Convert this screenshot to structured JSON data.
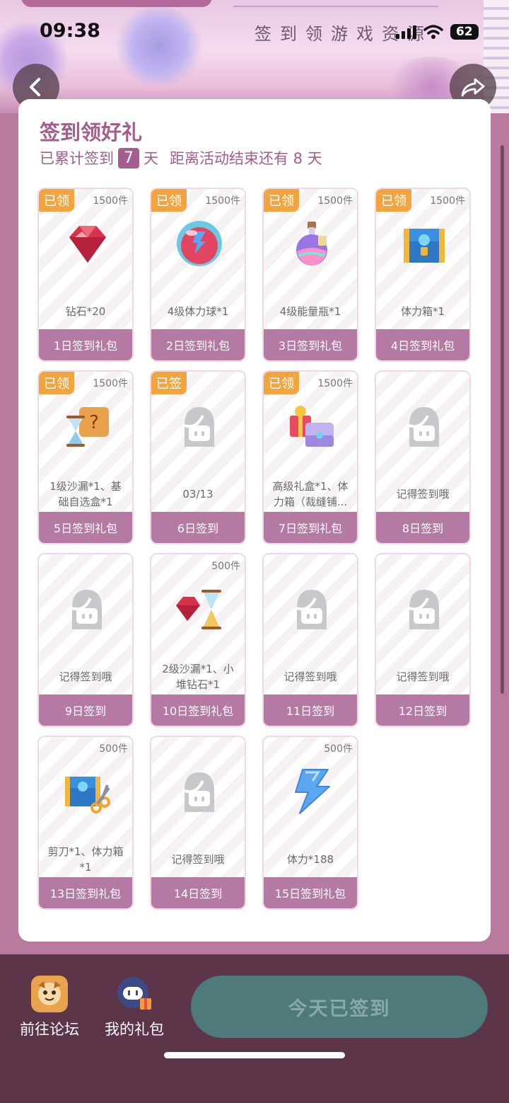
{
  "status": {
    "time": "09:38",
    "battery": "62"
  },
  "banner_title": "签到领游戏资源",
  "card": {
    "title": "签到领好礼",
    "sub_prefix": "已累计签到",
    "days": "7",
    "sub_day": "天",
    "sub_remaining": "距离活动结束还有 8 天"
  },
  "tiles": [
    {
      "badge": "已领",
      "qty": "1500件",
      "desc": "钻石*20",
      "foot": "1日签到礼包",
      "icon": "ruby-gem-icon"
    },
    {
      "badge": "已领",
      "qty": "1500件",
      "desc": "4级体力球*1",
      "foot": "2日签到礼包",
      "icon": "energy-orb-icon"
    },
    {
      "badge": "已领",
      "qty": "1500件",
      "desc": "4级能量瓶*1",
      "foot": "3日签到礼包",
      "icon": "potion-bottle-icon"
    },
    {
      "badge": "已领",
      "qty": "1500件",
      "desc": "体力箱*1",
      "foot": "4日签到礼包",
      "icon": "treasure-chest-icon"
    },
    {
      "badge": "已领",
      "qty": "1500件",
      "desc": "1级沙漏*1、基础自选盒*1",
      "foot": "5日签到礼包",
      "icon": "hourglass-box-icon"
    },
    {
      "badge": "已签",
      "qty": "",
      "desc": "03/13",
      "foot": "6日签到",
      "icon": "placeholder-avatar-icon"
    },
    {
      "badge": "已领",
      "qty": "1500件",
      "desc": "高级礼盒*1、体力箱（裁缝铺...",
      "foot": "7日签到礼包",
      "icon": "gift-chest-icon"
    },
    {
      "badge": "",
      "qty": "",
      "desc": "记得签到哦",
      "foot": "8日签到",
      "icon": "placeholder-avatar-icon"
    },
    {
      "badge": "",
      "qty": "",
      "desc": "记得签到哦",
      "foot": "9日签到",
      "icon": "placeholder-avatar-icon"
    },
    {
      "badge": "",
      "qty": "500件",
      "desc": "2级沙漏*1、小堆钻石*1",
      "foot": "10日签到礼包",
      "icon": "gems-hourglass-icon"
    },
    {
      "badge": "",
      "qty": "",
      "desc": "记得签到哦",
      "foot": "11日签到",
      "icon": "placeholder-avatar-icon"
    },
    {
      "badge": "",
      "qty": "",
      "desc": "记得签到哦",
      "foot": "12日签到",
      "icon": "placeholder-avatar-icon"
    },
    {
      "badge": "",
      "qty": "500件",
      "desc": "剪刀*1、体力箱*1",
      "foot": "13日签到礼包",
      "icon": "scissors-chest-icon"
    },
    {
      "badge": "",
      "qty": "",
      "desc": "记得签到哦",
      "foot": "14日签到",
      "icon": "placeholder-avatar-icon"
    },
    {
      "badge": "",
      "qty": "500件",
      "desc": "体力*188",
      "foot": "15日签到礼包",
      "icon": "lightning-icon"
    }
  ],
  "bottom": {
    "forum_label": "前往论坛",
    "gifts_label": "我的礼包",
    "signed_label": "今天已签到"
  },
  "colors": {
    "accent": "#a35d8e",
    "badge": "#f2a43f",
    "footer": "#b47aa3",
    "signed_button": "#4e7a7c"
  }
}
